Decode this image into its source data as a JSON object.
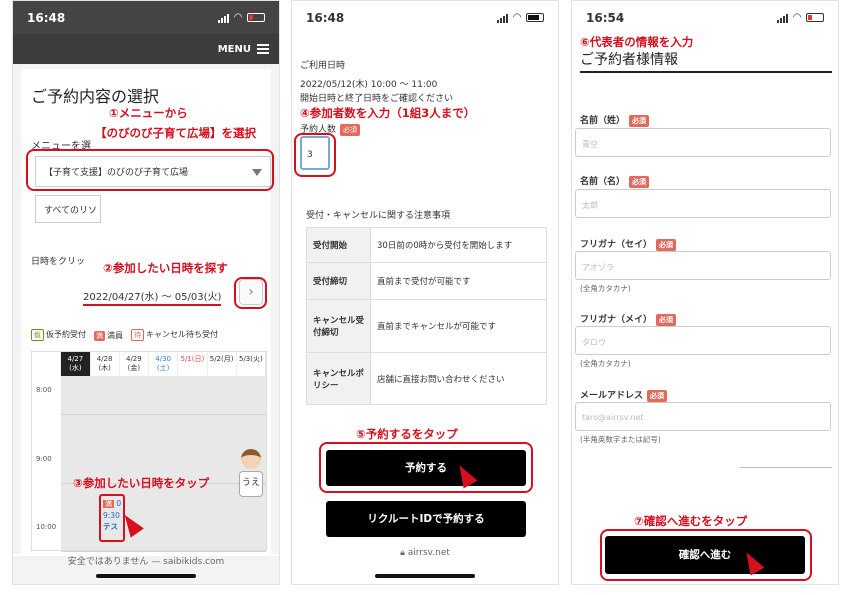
{
  "phone1": {
    "time": "16:48",
    "menu_label": "MENU",
    "title": "ご予約内容の選択",
    "step1a": "①メニューから",
    "step1b": "【のびのび子育て広場】を選択",
    "menu_field_label": "メニューを選",
    "menu_select_value": "【子育て支援】のびのび子育て広場",
    "secondary_select_value": "すべてのリソ",
    "date_label": "日時をクリッ",
    "step2": "②参加したい日時を探す",
    "date_range": "2022/04/27(水) 〜 05/03(火)",
    "next_icon": "›",
    "legend": [
      {
        "badge": "仮",
        "text": "仮予約受付",
        "color": "#6b8e23"
      },
      {
        "badge": "満",
        "text": "満員",
        "color": "#e26a5a"
      },
      {
        "badge": "待",
        "text": "キャンセル待ち受付",
        "color": "#e26a5a"
      }
    ],
    "calendar_days": [
      {
        "date": "4/27",
        "dow": "(水)",
        "color": "#ffffff",
        "bg": "#222222"
      },
      {
        "date": "4/28",
        "dow": "(木)",
        "color": "#333333",
        "bg": "#ffffff"
      },
      {
        "date": "4/29",
        "dow": "(金)",
        "color": "#333333",
        "bg": "#ffffff"
      },
      {
        "date": "4/30",
        "dow": "(土)",
        "color": "#2a7fd4",
        "bg": "#ffffff"
      },
      {
        "date": "5/1(日)",
        "dow": "",
        "color": "#e0474c",
        "bg": "#ffffff"
      },
      {
        "date": "5/2(月)",
        "dow": "",
        "color": "#333333",
        "bg": "#ffffff"
      },
      {
        "date": "5/3(火)",
        "dow": "",
        "color": "#333333",
        "bg": "#ffffff"
      }
    ],
    "times": [
      "8:00",
      "9:00",
      "10:00"
    ],
    "step3": "③参加したい日時をタップ",
    "slot_status": "満",
    "slot_count": "0",
    "slot_time": "9:30",
    "slot_name": "テス",
    "mascot_label": "うえ",
    "url": "安全ではありません — saibikids.com"
  },
  "phone2": {
    "time": "16:48",
    "date_label": "ご利用日時",
    "date_value": "2022/05/12(木) 10:00 〜 11:00",
    "date_note": "開始日時と終了日時をご確認ください",
    "step4": "④参加者数を入力（1組3人まで）",
    "people_label": "予約人数",
    "required": "必須",
    "people_value": "3",
    "rules_title": "受付・キャンセルに関する注意事項",
    "rules": [
      {
        "key": "受付開始",
        "value": "30日前の0時から受付を開始します"
      },
      {
        "key": "受付締切",
        "value": "直前まで受付が可能です"
      },
      {
        "key": "キャンセル受付締切",
        "value": "直前までキャンセルが可能です"
      },
      {
        "key": "キャンセルポリシー",
        "value": "店舗に直接お問い合わせください"
      }
    ],
    "step5": "⑤予約するをタップ",
    "reserve_button": "予約する",
    "recruit_button": "リクルートIDで予約する",
    "url": "airrsv.net"
  },
  "phone3": {
    "time": "16:54",
    "step6": "⑥代表者の情報を入力",
    "title": "ご予約者様情報",
    "required": "必須",
    "fields": [
      {
        "label": "名前（姓）",
        "placeholder": "青空",
        "note": ""
      },
      {
        "label": "名前（名）",
        "placeholder": "太郎",
        "note": ""
      },
      {
        "label": "フリガナ（セイ）",
        "placeholder": "アオゾラ",
        "note": "(全角カタカナ)"
      },
      {
        "label": "フリガナ（メイ）",
        "placeholder": "タロウ",
        "note": "(全角カタカナ)"
      },
      {
        "label": "メールアドレス",
        "placeholder": "taro@airrsv.net",
        "note": "(半角英数字または記号)"
      }
    ],
    "step7": "⑦確認へ進むをタップ",
    "confirm_button": "確認へ進む"
  },
  "colors": {
    "annotation_red": "#d6101e",
    "required_badge": "#e26a5a"
  }
}
